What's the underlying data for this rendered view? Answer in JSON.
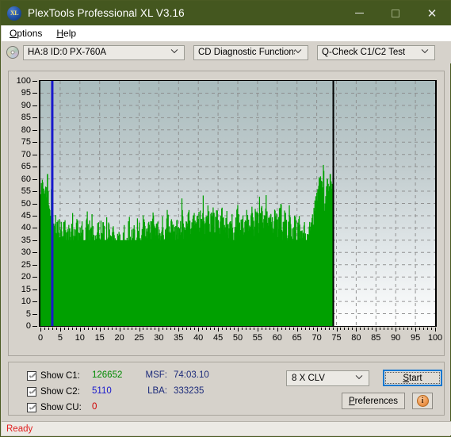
{
  "window": {
    "title": "PlexTools Professional XL V3.16",
    "icon": "xl-app-icon",
    "minimize_label": "minimize",
    "maximize_label": "maximize",
    "close_label": "close"
  },
  "menubar": {
    "items": [
      {
        "label": "Options",
        "accel": "O",
        "name": "menu-options"
      },
      {
        "label": "Help",
        "accel": "H",
        "name": "menu-help"
      }
    ]
  },
  "toolbar": {
    "drive_icon": "cd-disc-icon",
    "drive_select": {
      "value": "HA:8 ID:0  PX-760A"
    },
    "function_select": {
      "value": "CD Diagnostic Functions"
    },
    "test_select": {
      "value": "Q-Check C1/C2 Test"
    }
  },
  "bottom": {
    "show_c1": {
      "label": "Show C1:",
      "value": "126652",
      "color": "#008a00",
      "checked": true
    },
    "show_c2": {
      "label": "Show C2:",
      "value": "5110",
      "color": "#1818cc",
      "checked": true
    },
    "show_cu": {
      "label": "Show CU:",
      "value": "0",
      "color": "#d00000",
      "checked": true
    },
    "msf": {
      "label": "MSF:",
      "value": "74:03.10"
    },
    "lba": {
      "label": "LBA:",
      "value": "333235"
    },
    "speed_select": {
      "value": "8 X CLV"
    },
    "start_button": {
      "label": "Start",
      "accel": "S"
    },
    "preferences_button": {
      "label": "Preferences",
      "accel": "P"
    },
    "info_button": {
      "label": "i",
      "tooltip": "info"
    }
  },
  "statusbar": {
    "text": "Ready",
    "color": "#e02020"
  },
  "chart_data": {
    "type": "bar",
    "title": "",
    "xlabel": "",
    "ylabel": "",
    "xlim": [
      0,
      100
    ],
    "ylim": [
      0,
      100
    ],
    "xticks": [
      0,
      5,
      10,
      15,
      20,
      25,
      30,
      35,
      40,
      45,
      50,
      55,
      60,
      65,
      70,
      75,
      80,
      85,
      90,
      95,
      100
    ],
    "yticks": [
      0,
      5,
      10,
      15,
      20,
      25,
      30,
      35,
      40,
      45,
      50,
      55,
      60,
      65,
      70,
      75,
      80,
      85,
      90,
      95,
      100
    ],
    "grid": true,
    "legend": "none",
    "colors": {
      "c1": "#00a000",
      "c2": "#1818cc",
      "cu": "#d00000",
      "marker": "#1818cc"
    },
    "markers": [
      {
        "name": "c2-marker-line",
        "x": 3.0,
        "color": "#1818cc"
      },
      {
        "name": "data-end-line",
        "x": 74.2,
        "color": "#000000"
      }
    ],
    "data_end_x": 74.2,
    "series": [
      {
        "name": "C1 errors",
        "color": "#00a000",
        "x": [
          0.4,
          0.7,
          1.0,
          1.3,
          1.6,
          1.9,
          2.2,
          2.5,
          2.8,
          3.1,
          3.4,
          3.7,
          4.0,
          4.3,
          4.6,
          4.9,
          5.2,
          5.5,
          5.8,
          6.1,
          6.4,
          6.7,
          7.0,
          7.3,
          7.6,
          7.9,
          8.2,
          8.5,
          8.8,
          9.1,
          9.4,
          9.7,
          10.0,
          10.3,
          10.6,
          10.9,
          11.2,
          11.5,
          11.8,
          12.1,
          12.4,
          12.7,
          13.0,
          13.3,
          13.6,
          13.9,
          14.2,
          14.5,
          14.8,
          15.1,
          15.4,
          15.7,
          16.0,
          16.3,
          16.6,
          16.9,
          17.2,
          17.5,
          17.8,
          18.1,
          18.4,
          18.7,
          19.0,
          19.3,
          19.6,
          19.9,
          20.2,
          20.5,
          20.8,
          21.1,
          21.4,
          21.7,
          22.0,
          22.3,
          22.6,
          22.9,
          23.2,
          23.5,
          23.8,
          24.1,
          24.4,
          24.7,
          25.0,
          25.3,
          25.6,
          25.9,
          26.2,
          26.5,
          26.8,
          27.1,
          27.4,
          27.7,
          28.0,
          28.3,
          28.6,
          28.9,
          29.2,
          29.5,
          29.8,
          30.1,
          30.4,
          30.7,
          31.0,
          31.3,
          31.6,
          31.9,
          32.2,
          32.5,
          32.8,
          33.1,
          33.4,
          33.7,
          34.0,
          34.3,
          34.6,
          34.9,
          35.2,
          35.5,
          35.8,
          36.1,
          36.4,
          36.7,
          37.0,
          37.3,
          37.6,
          37.9,
          38.2,
          38.5,
          38.8,
          39.1,
          39.4,
          39.7,
          40.0,
          40.3,
          40.6,
          40.9,
          41.2,
          41.5,
          41.8,
          42.1,
          42.4,
          42.7,
          43.0,
          43.3,
          43.6,
          43.9,
          44.2,
          44.5,
          44.8,
          45.1,
          45.4,
          45.7,
          46.0,
          46.3,
          46.6,
          46.9,
          47.2,
          47.5,
          47.8,
          48.1,
          48.4,
          48.7,
          49.0,
          49.3,
          49.6,
          49.9,
          50.2,
          50.5,
          50.8,
          51.1,
          51.4,
          51.7,
          52.0,
          52.3,
          52.6,
          52.9,
          53.2,
          53.5,
          53.8,
          54.1,
          54.4,
          54.7,
          55.0,
          55.3,
          55.6,
          55.9,
          56.2,
          56.5,
          56.8,
          57.1,
          57.4,
          57.7,
          58.0,
          58.3,
          58.6,
          58.9,
          59.2,
          59.5,
          59.8,
          60.1,
          60.4,
          60.7,
          61.0,
          61.3,
          61.6,
          61.9,
          62.2,
          62.5,
          62.8,
          63.1,
          63.4,
          63.7,
          64.0,
          64.3,
          64.6,
          64.9,
          65.2,
          65.5,
          65.8,
          66.1,
          66.4,
          66.7,
          67.0,
          67.3,
          67.6,
          67.9,
          68.2,
          68.5,
          68.8,
          69.1,
          69.4,
          69.7,
          70.0,
          70.3,
          70.6,
          70.9,
          71.2,
          71.5,
          71.8,
          72.1,
          72.4,
          72.7,
          73.0,
          73.3,
          73.6,
          73.9,
          74.1
        ],
        "values": [
          52,
          57,
          55,
          49,
          54,
          52,
          47,
          50,
          38,
          62,
          40,
          37,
          39,
          36,
          41,
          37,
          34,
          39,
          36,
          38,
          41,
          36,
          35,
          38,
          40,
          36,
          41,
          37,
          35,
          39,
          41,
          36,
          34,
          37,
          40,
          42,
          33,
          31,
          38,
          45,
          36,
          34,
          39,
          46,
          35,
          33,
          36,
          40,
          43,
          38,
          34,
          36,
          42,
          39,
          33,
          31,
          35,
          40,
          36,
          33,
          38,
          41,
          35,
          30,
          33,
          38,
          36,
          31,
          29,
          34,
          37,
          33,
          30,
          32,
          36,
          34,
          31,
          33,
          38,
          36,
          32,
          35,
          40,
          38,
          34,
          36,
          42,
          39,
          35,
          38,
          44,
          40,
          36,
          39,
          46,
          41,
          37,
          40,
          43,
          38,
          35,
          38,
          42,
          39,
          36,
          40,
          45,
          41,
          37,
          39,
          43,
          40,
          36,
          38,
          42,
          39,
          35,
          38,
          41,
          44,
          40,
          37,
          39,
          43,
          46,
          41,
          38,
          40,
          44,
          42,
          38,
          41,
          45,
          42,
          39,
          41,
          47,
          43,
          39,
          42,
          46,
          43,
          40,
          43,
          48,
          44,
          40,
          43,
          46,
          42,
          39,
          42,
          45,
          41,
          38,
          41,
          44,
          40,
          37,
          40,
          43,
          39,
          36,
          39,
          42,
          45,
          41,
          38,
          41,
          44,
          41,
          38,
          41,
          45,
          42,
          38,
          41,
          46,
          42,
          39,
          42,
          47,
          43,
          40,
          43,
          48,
          44,
          41,
          44,
          50,
          45,
          41,
          44,
          47,
          43,
          40,
          43,
          46,
          42,
          39,
          42,
          45,
          41,
          38,
          41,
          44,
          40,
          37,
          40,
          43,
          39,
          36,
          39,
          42,
          38,
          35,
          38,
          41,
          37,
          34,
          37,
          40,
          36,
          33,
          36,
          39,
          42,
          38,
          41,
          44,
          47,
          50,
          53,
          57,
          60,
          58,
          55,
          57,
          62
        ]
      }
    ],
    "notes": "C1 error-rate bar/spike plot; dense green fill from x=0 to x=74.2, baseline filled to 0; background gradient grey-blue to white; dashed grey grid."
  }
}
